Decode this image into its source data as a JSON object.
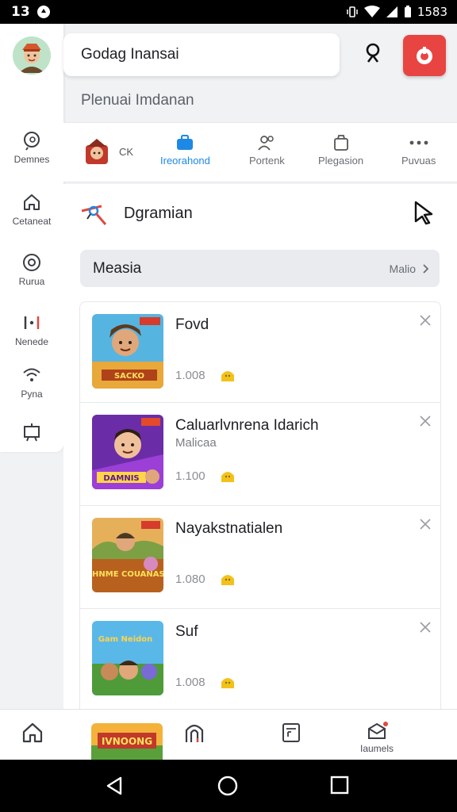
{
  "status_bar": {
    "time": "13",
    "battery": "1583"
  },
  "search": {
    "value": "Godag Inansai"
  },
  "subtitle": "Plenuai Imdanan",
  "left_rail": {
    "items": [
      {
        "label": "Demnes",
        "icon": "search-chat-icon"
      },
      {
        "label": "Cetaneat",
        "icon": "home-icon"
      },
      {
        "label": "Rurua",
        "icon": "at-sign-icon"
      },
      {
        "label": "Nenede",
        "icon": "split-icon"
      },
      {
        "label": "Pyna",
        "icon": "wifi-icon"
      },
      {
        "label": "",
        "icon": "present-icon"
      }
    ]
  },
  "tabs": {
    "first": "CK",
    "items": [
      {
        "label": "Ireorahond",
        "icon": "briefcase-icon",
        "active": true
      },
      {
        "label": "Portenk",
        "icon": "people-icon",
        "active": false
      },
      {
        "label": "Plegasion",
        "icon": "box-icon",
        "active": false
      },
      {
        "label": "Puvuas",
        "icon": "more-dots-icon",
        "active": false
      }
    ]
  },
  "section": {
    "title": "Dgramian"
  },
  "filter": {
    "title": "Measia",
    "more": "Malio"
  },
  "cards": [
    {
      "title": "Fovd",
      "sub": "",
      "count": "1.008"
    },
    {
      "title": "Caluarlvnrena Idarich",
      "sub": "Malicaa",
      "count": "1.100"
    },
    {
      "title": "Nayakstnatialen",
      "sub": "",
      "count": "1.080"
    },
    {
      "title": "Suf",
      "sub": "",
      "count": "1.008"
    }
  ],
  "thumb_texts": [
    "SACKO",
    "DAMNIS",
    "IHNME COUANAS",
    "Gam Neidon"
  ],
  "bottom_nav": {
    "promo": "IVNOONG",
    "items": [
      {
        "label": "",
        "icon": "home-icon"
      },
      {
        "label": "",
        "icon": "arch-icon"
      },
      {
        "label": "",
        "icon": "doc-icon"
      },
      {
        "label": "Iaumels",
        "icon": "mail-icon"
      }
    ]
  },
  "colors": {
    "accent": "#1e88e5",
    "red": "#e84542",
    "coin": "#f2c21b"
  }
}
